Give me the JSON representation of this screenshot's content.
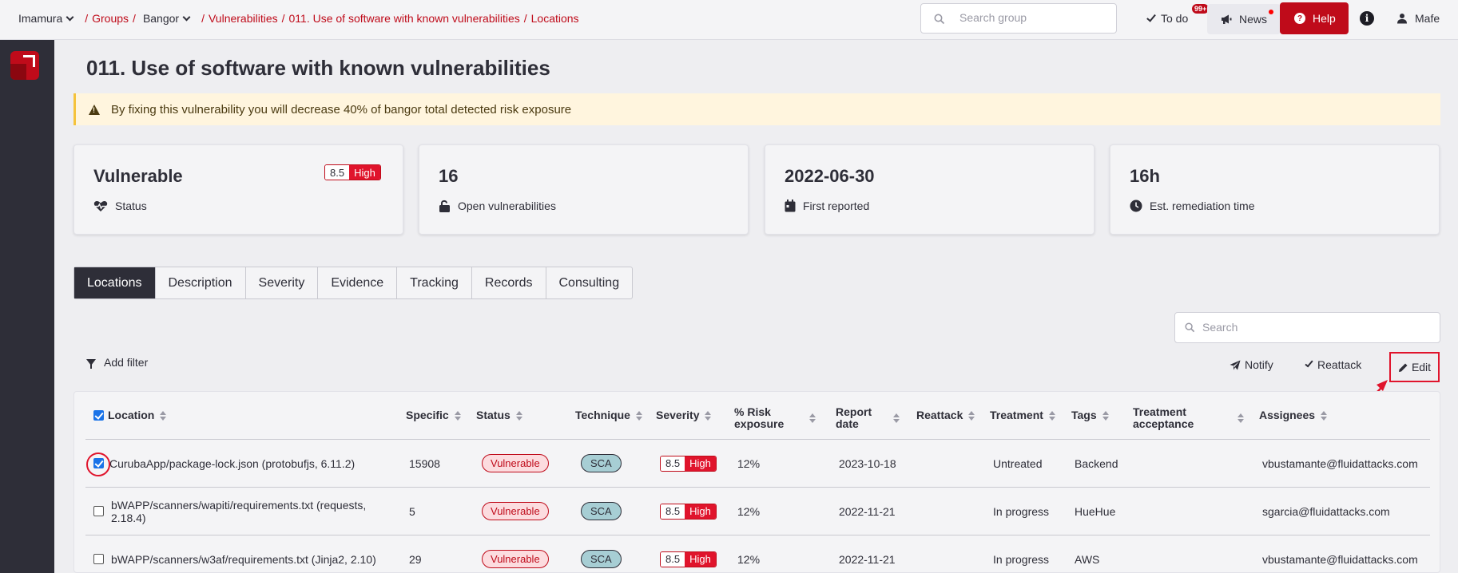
{
  "breadcrumb": {
    "org": "Imamura",
    "groups": "Groups",
    "group": "Bangor",
    "vulnerabilities": "Vulnerabilities",
    "finding": "011. Use of software with known vulnerabilities",
    "current": "Locations"
  },
  "topbar": {
    "search_placeholder": "Search group",
    "todo_label": "To do",
    "todo_badge": "99+",
    "news_label": "News",
    "help_label": "Help",
    "user_name": "Mafe"
  },
  "page": {
    "title": "011. Use of software with known vulnerabilities",
    "alert": "By fixing this vulnerability you will decrease 40% of bangor total detected risk exposure"
  },
  "cards": [
    {
      "value": "Vulnerable",
      "label": "Status",
      "icon": "heart-pulse-icon",
      "severity_score": "8.5",
      "severity_level": "High"
    },
    {
      "value": "16",
      "label": "Open vulnerabilities",
      "icon": "unlock-icon"
    },
    {
      "value": "2022-06-30",
      "label": "First reported",
      "icon": "calendar-icon"
    },
    {
      "value": "16h",
      "label": "Est. remediation time",
      "icon": "clock-icon"
    }
  ],
  "tabs": [
    "Locations",
    "Description",
    "Severity",
    "Evidence",
    "Tracking",
    "Records",
    "Consulting"
  ],
  "table_tools": {
    "search_placeholder": "Search",
    "add_filter": "Add filter",
    "notify": "Notify",
    "reattack": "Reattack",
    "edit": "Edit"
  },
  "table": {
    "columns": [
      "Location",
      "Specific",
      "Status",
      "Technique",
      "Severity",
      "% Risk exposure",
      "Report date",
      "Reattack",
      "Treatment",
      "Tags",
      "Treatment acceptance",
      "Assignees"
    ],
    "rows": [
      {
        "checked": true,
        "location": "CurubaApp/package-lock.json (protobufjs, 6.11.2)",
        "specific": "15908",
        "status": "Vulnerable",
        "technique": "SCA",
        "sev_score": "8.5",
        "sev_level": "High",
        "risk": "12%",
        "report_date": "2023-10-18",
        "reattack": "",
        "treatment": "Untreated",
        "tags": "Backend",
        "acceptance": "",
        "assignee": "vbustamante@fluidattacks.com"
      },
      {
        "checked": false,
        "location": "bWAPP/scanners/wapiti/requirements.txt (requests, 2.18.4)",
        "specific": "5",
        "status": "Vulnerable",
        "technique": "SCA",
        "sev_score": "8.5",
        "sev_level": "High",
        "risk": "12%",
        "report_date": "2022-11-21",
        "reattack": "",
        "treatment": "In progress",
        "tags": "HueHue",
        "acceptance": "",
        "assignee": "sgarcia@fluidattacks.com"
      },
      {
        "checked": false,
        "location": "bWAPP/scanners/w3af/requirements.txt (Jinja2, 2.10)",
        "specific": "29",
        "status": "Vulnerable",
        "technique": "SCA",
        "sev_score": "8.5",
        "sev_level": "High",
        "risk": "12%",
        "report_date": "2022-11-21",
        "reattack": "",
        "treatment": "In progress",
        "tags": "AWS",
        "acceptance": "",
        "assignee": "vbustamante@fluidattacks.com"
      }
    ]
  },
  "colors": {
    "brand_red": "#bf0b1a",
    "dark": "#2e2e38",
    "alert_bg": "#fff5de",
    "technique_bg": "#a7ced4"
  }
}
